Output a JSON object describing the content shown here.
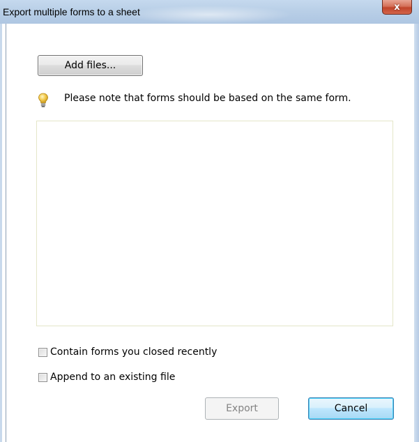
{
  "window": {
    "title": "Export multiple forms to a sheet",
    "close_glyph": "x"
  },
  "toolbar": {
    "add_files_label": "Add files..."
  },
  "note": {
    "icon": "lightbulb-icon",
    "text": "Please note that forms should be based on the same form."
  },
  "file_list": {
    "items": []
  },
  "options": {
    "contain_recent_label": "Contain forms you closed recently",
    "contain_recent_checked": false,
    "append_existing_label": "Append to an existing file",
    "append_existing_checked": false
  },
  "footer": {
    "export_label": "Export",
    "export_enabled": false,
    "cancel_label": "Cancel"
  },
  "colors": {
    "titlebar": "#b9cfe7",
    "close_button": "#c0442a",
    "default_button_border": "#3c7fb1",
    "list_border": "#e4e6c8",
    "disabled_text": "#838383"
  }
}
